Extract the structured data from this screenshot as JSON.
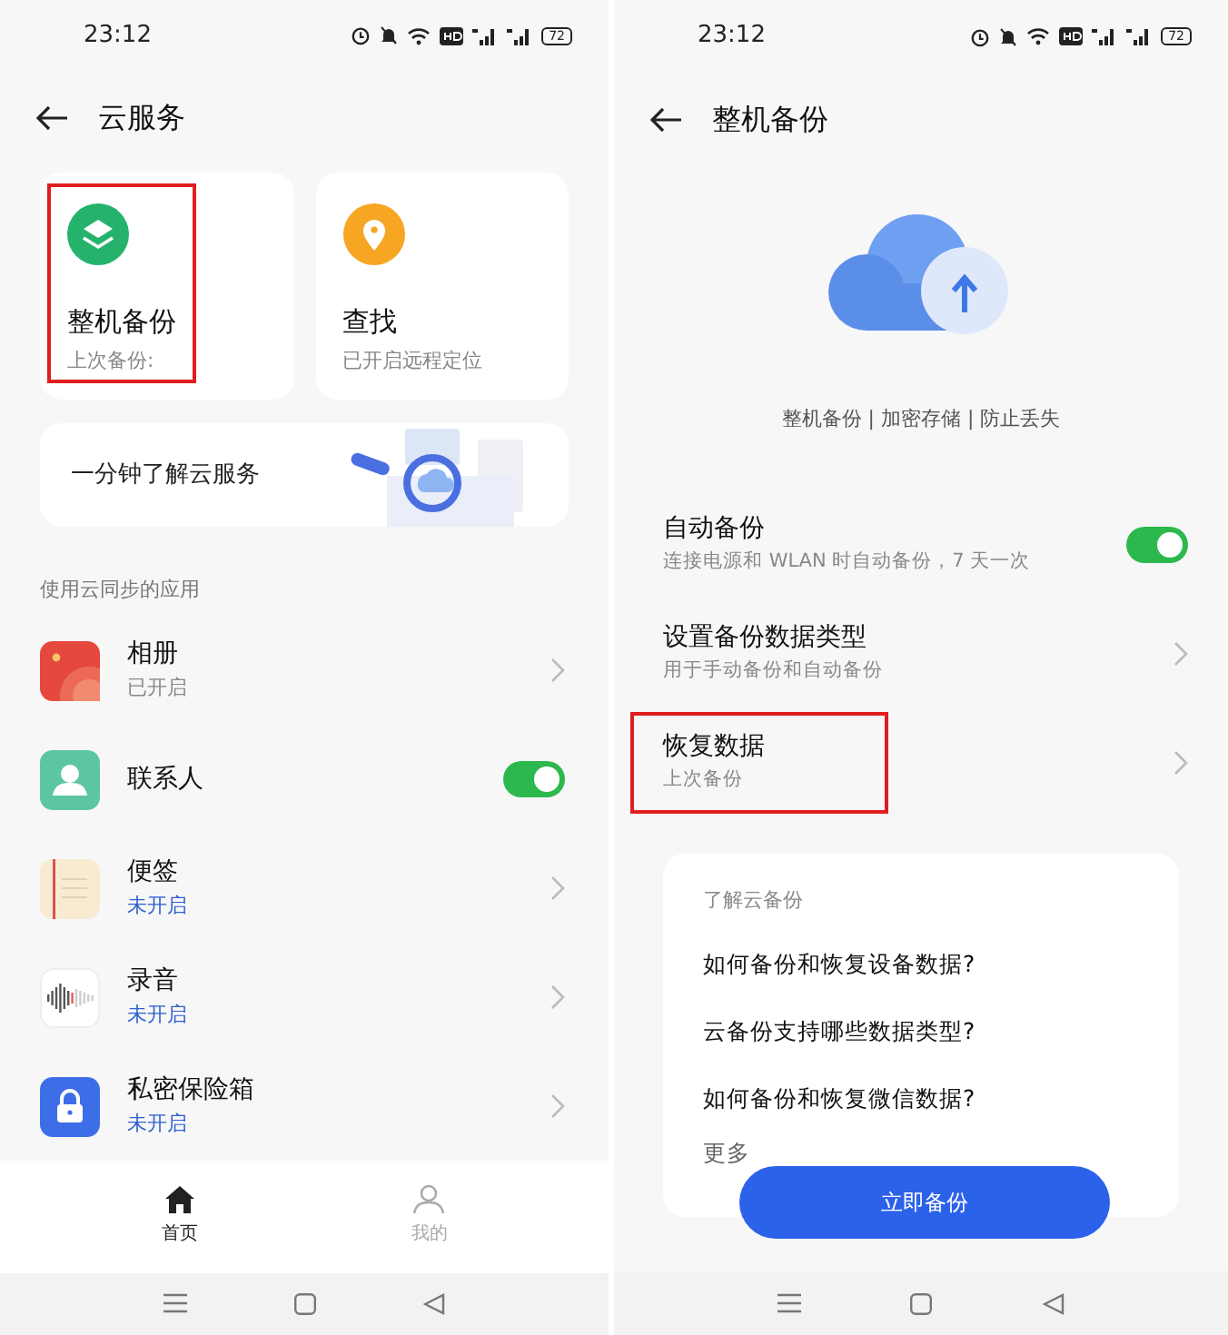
{
  "left_screen": {
    "status_bar": {
      "time": "23:12",
      "battery": "72"
    },
    "title": "云服务",
    "cards": [
      {
        "kind": "backup",
        "title": "整机备份",
        "subtitle": "上次备份:",
        "highlighted": true
      },
      {
        "kind": "find",
        "title": "查找",
        "subtitle": "已开启远程定位",
        "highlighted": false
      }
    ],
    "banner": {
      "text": "一分钟了解云服务"
    },
    "section_label": "使用云同步的应用",
    "apps": [
      {
        "kind": "gallery",
        "name": "相册",
        "status": "已开启",
        "enabled": true
      },
      {
        "kind": "contacts",
        "name": "联系人",
        "on": true
      },
      {
        "kind": "notes",
        "name": "便签",
        "status": "未开启",
        "enabled": false
      },
      {
        "kind": "recorder",
        "name": "录音",
        "status": "未开启",
        "enabled": false
      },
      {
        "kind": "vault",
        "name": "私密保险箱",
        "status": "未开启",
        "enabled": false
      }
    ],
    "bottom_nav": [
      {
        "kind": "home",
        "label": "首页",
        "selected": true
      },
      {
        "kind": "profile",
        "label": "我的",
        "selected": false
      }
    ]
  },
  "right_screen": {
    "status_bar": {
      "time": "23:12",
      "battery": "72"
    },
    "title": "整机备份",
    "tagline": "整机备份 | 加密存储 | 防止丢失",
    "settings": [
      {
        "kind": "toggle",
        "title": "自动备份",
        "subtitle": "连接电源和 WLAN 时自动备份，7 天一次",
        "on": true,
        "highlighted": false
      },
      {
        "kind": "link",
        "title": "设置备份数据类型",
        "subtitle": "用于手动备份和自动备份",
        "highlighted": false
      },
      {
        "kind": "link",
        "title": "恢复数据",
        "subtitle": "上次备份",
        "highlighted": true
      }
    ],
    "help_card": {
      "title": "了解云备份",
      "questions": [
        "如何备份和恢复设备数据?",
        "云备份支持哪些数据类型?",
        "如何备份和恢复微信数据?"
      ],
      "more": "更多"
    },
    "primary_button": "立即备份"
  }
}
